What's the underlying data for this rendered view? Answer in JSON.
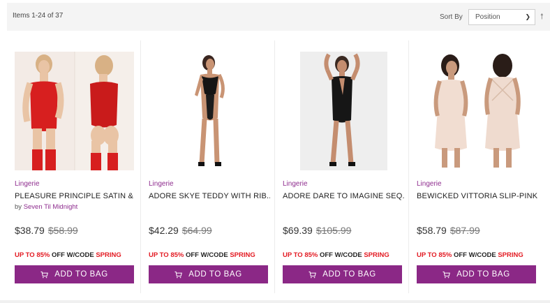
{
  "toolbar": {
    "items_count": "Items 1-24 of 37",
    "sort_label": "Sort By",
    "sort_value": "Position",
    "sort_icon": "arrow-up-icon"
  },
  "products": [
    {
      "category": "Lingerie",
      "name": "PLEASURE PRINCIPLE SATIN & ...",
      "by": "by",
      "brand": "Seven Til Midnight",
      "price": "$38.79",
      "old_price": "$58.99",
      "promo_a": "UP TO 85%",
      "promo_b": " OFF W/CODE ",
      "promo_c": "SPRING",
      "button": "ADD TO BAG"
    },
    {
      "category": "Lingerie",
      "name": "ADORE SKYE TEDDY WITH RIB...",
      "price": "$42.29",
      "old_price": "$64.99",
      "promo_a": "UP TO 85%",
      "promo_b": " OFF W/CODE ",
      "promo_c": "SPRING",
      "button": "ADD TO BAG"
    },
    {
      "category": "Lingerie",
      "name": "ADORE DARE TO IMAGINE SEQ...",
      "price": "$69.39",
      "old_price": "$105.99",
      "promo_a": "UP TO 85%",
      "promo_b": " OFF W/CODE ",
      "promo_c": "SPRING",
      "button": "ADD TO BAG"
    },
    {
      "category": "Lingerie",
      "name": "BEWICKED VITTORIA SLIP-PINK",
      "price": "$58.79",
      "old_price": "$87.99",
      "promo_a": "UP TO 85%",
      "promo_b": " OFF W/CODE ",
      "promo_c": "SPRING",
      "button": "ADD TO BAG"
    }
  ],
  "colors": {
    "accent": "#8b2886",
    "promo_red": "#e31b23",
    "category": "#8e2c8e"
  }
}
